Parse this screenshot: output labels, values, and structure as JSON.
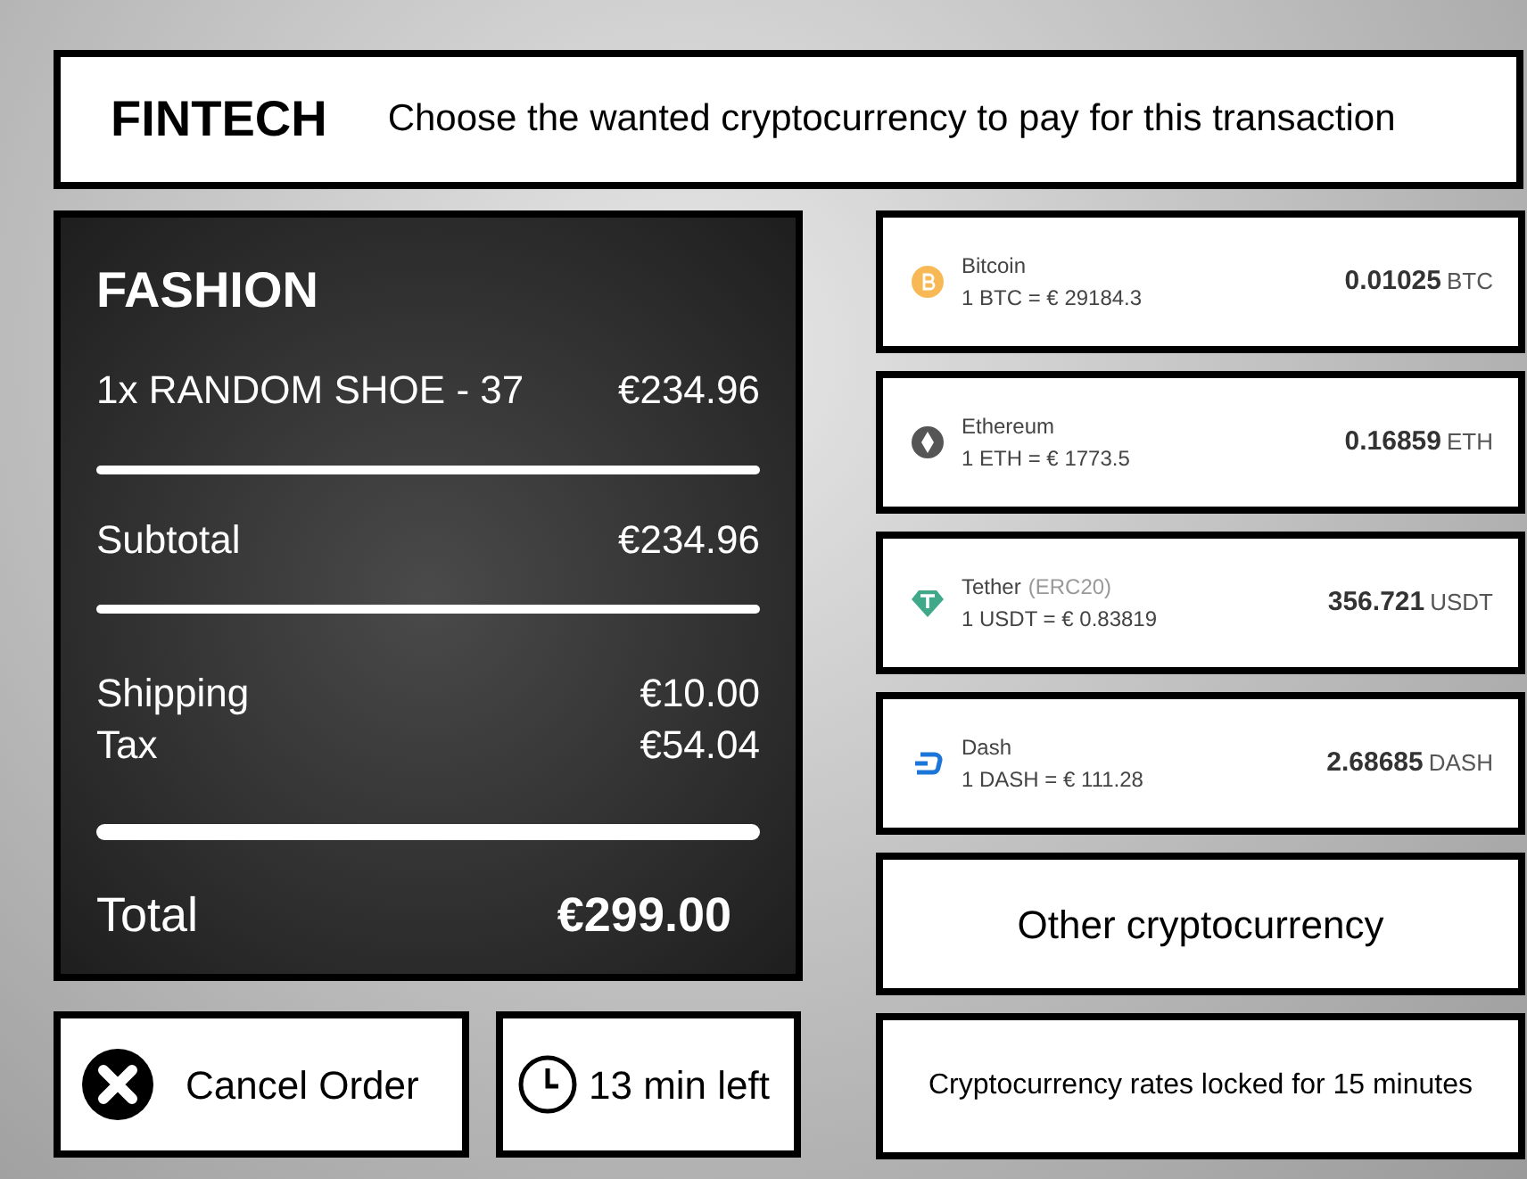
{
  "header": {
    "brand": "FINTECH",
    "instruction": "Choose the wanted cryptocurrency to pay for this transaction"
  },
  "order": {
    "store": "FASHION",
    "items": [
      {
        "name": "1x RANDOM SHOE - 37",
        "price": "€234.96"
      }
    ],
    "subtotal": {
      "label": "Subtotal",
      "value": "€234.96"
    },
    "charges": [
      {
        "label": "Shipping",
        "value": "€10.00"
      },
      {
        "label": "Tax",
        "value": "€54.04"
      }
    ],
    "total": {
      "label": "Total",
      "value": "€299.00"
    }
  },
  "cancel_button": "Cancel Order",
  "timer": "13 min left",
  "coins": [
    {
      "kind": "bitcoin",
      "color": "#f7b955",
      "name": "Bitcoin",
      "rate": "1 BTC = € 29184.3",
      "amount": "0.01025",
      "unit": "BTC"
    },
    {
      "kind": "ethereum",
      "color": "#555555",
      "name": "Ethereum",
      "rate": "1 ETH = € 1773.5",
      "amount": "0.16859",
      "unit": "ETH"
    },
    {
      "kind": "tether",
      "color": "#3fa98a",
      "name": "Tether",
      "network": "(ERC20)",
      "rate": "1 USDT = € 0.83819",
      "amount": "356.721",
      "unit": "USDT"
    },
    {
      "kind": "dash",
      "color": "#1c75d8",
      "name": "Dash",
      "rate": "1 DASH = € 111.28",
      "amount": "2.68685",
      "unit": "DASH"
    }
  ],
  "other_button": "Other cryptocurrency",
  "rates_note": "Cryptocurrency rates locked for 15 minutes"
}
